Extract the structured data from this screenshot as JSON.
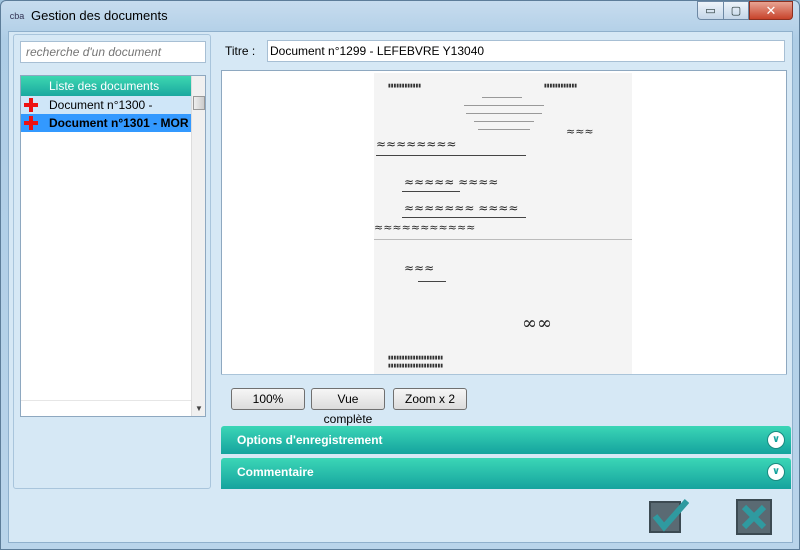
{
  "window": {
    "icon_text": "cba",
    "title": "Gestion des documents",
    "minimize": "▭",
    "maximize": "▢",
    "close": "✕"
  },
  "sidebar": {
    "search_placeholder": "recherche d'un document",
    "list_header": "Liste des documents",
    "items": [
      {
        "label": "Document n°1300 -"
      },
      {
        "label": "Document n°1301 - MOR"
      }
    ]
  },
  "main": {
    "title_label": "Titre :",
    "title_value": "Document n°1299 - LEFEBVRE Y13040",
    "toolbar": {
      "zoom_100": "100%",
      "full_view": "Vue complète",
      "zoom_x2": "Zoom x 2"
    },
    "sections": [
      {
        "label": "Options d'enregistrement"
      },
      {
        "label": "Commentaire"
      }
    ]
  },
  "colors": {
    "accent": "#1aa8a0",
    "selection": "#3399ff",
    "error_icon": "#e11111"
  }
}
